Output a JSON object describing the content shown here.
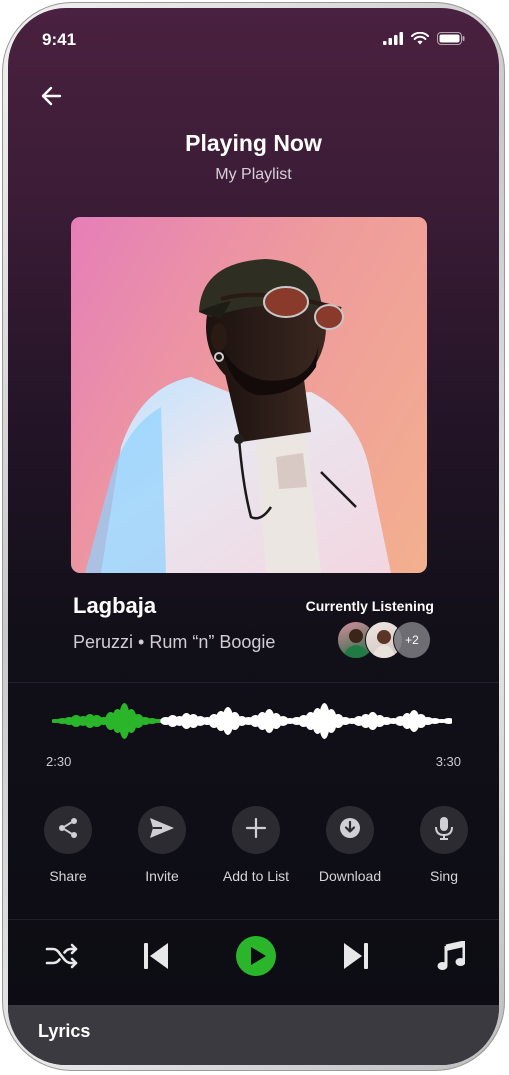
{
  "status_bar": {
    "time": "9:41",
    "icons": [
      "signal-icon",
      "wifi-icon",
      "battery-icon"
    ]
  },
  "header": {
    "back_icon": "arrow-left-icon",
    "title": "Playing Now",
    "subtitle": "My Playlist"
  },
  "track": {
    "title": "Lagbaja",
    "artist_line": "Peruzzi • Rum “n” Boogie"
  },
  "listeners": {
    "label": "Currently Listening",
    "more_count": "+2"
  },
  "progress": {
    "elapsed": "2:30",
    "total": "3:30",
    "played_fraction": 0.27
  },
  "actions": [
    {
      "label": "Share",
      "icon": "share-icon"
    },
    {
      "label": "Invite",
      "icon": "send-icon"
    },
    {
      "label": "Add to List",
      "icon": "plus-icon"
    },
    {
      "label": "Download",
      "icon": "download-icon"
    },
    {
      "label": "Sing",
      "icon": "microphone-icon"
    }
  ],
  "controls": [
    "shuffle-icon",
    "previous-icon",
    "play-icon",
    "next-icon",
    "music-note-icon"
  ],
  "lyrics": {
    "label": "Lyrics"
  },
  "colors": {
    "accent": "#2bb52b",
    "background_top": "#4a2140",
    "background_bottom": "#0c0c13",
    "wave_played": "#2bb52b",
    "wave_unplayed": "#ffffff"
  }
}
